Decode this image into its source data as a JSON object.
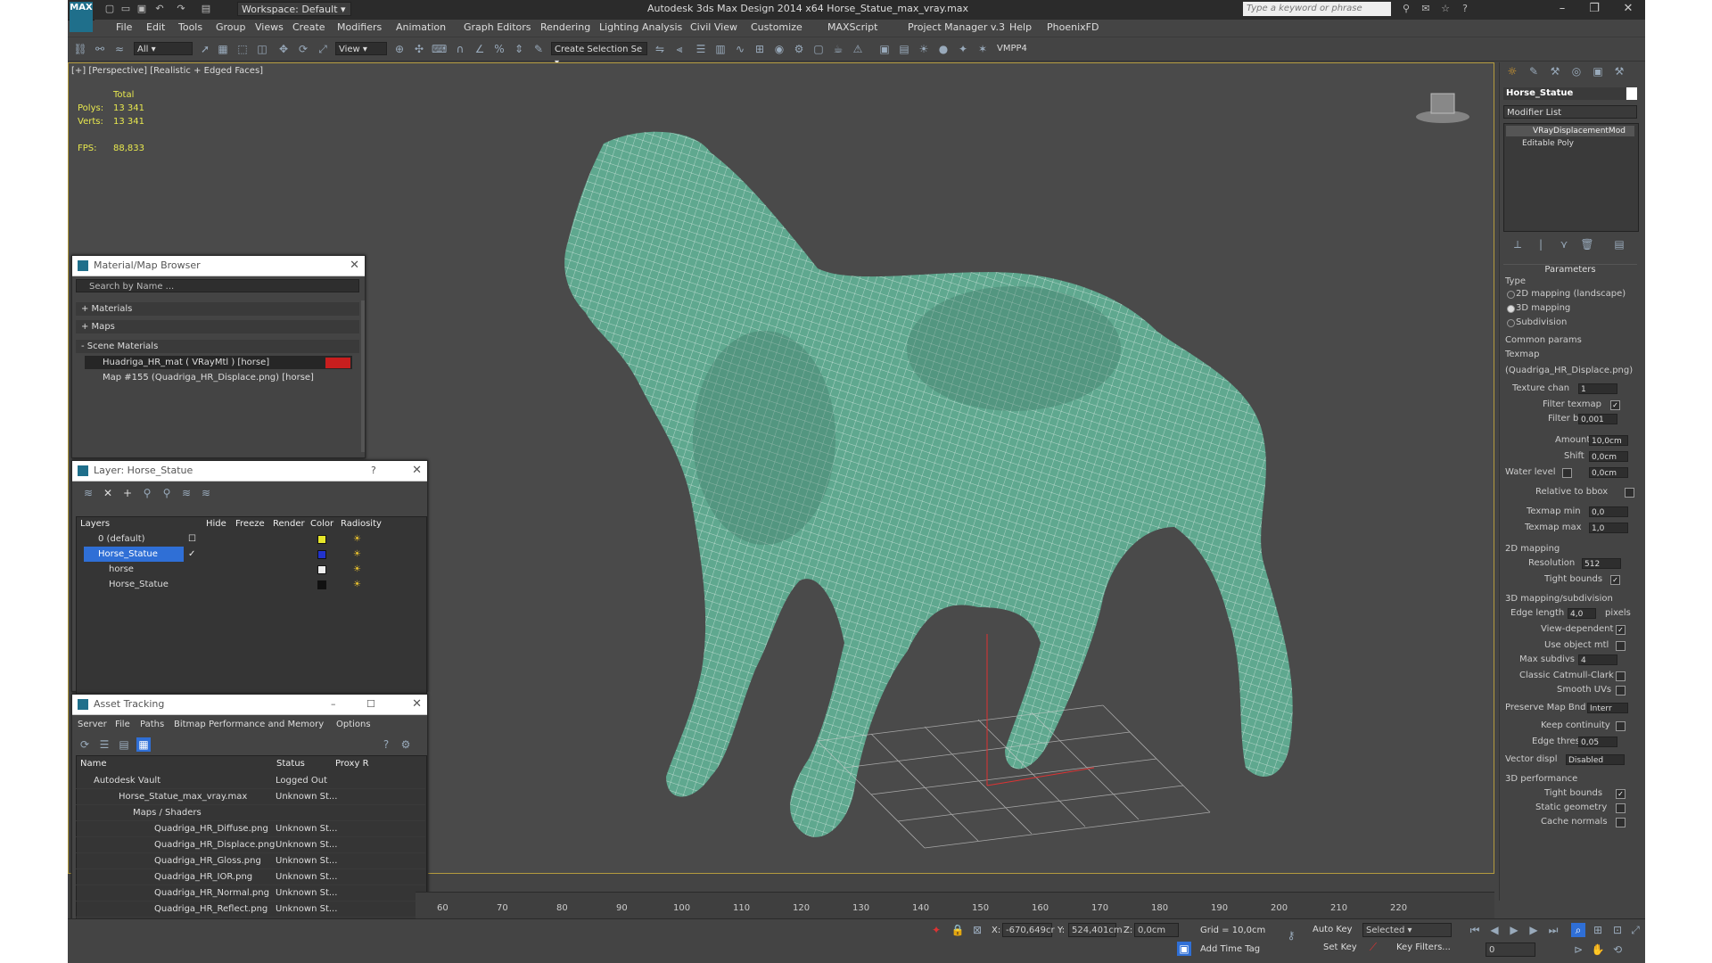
{
  "titlebar": {
    "app_title": "Autodesk 3ds Max Design 2014 x64      Horse_Statue_max_vray.max",
    "workspace": "Workspace: Default",
    "search_placeholder": "Type a keyword or phrase",
    "logo": "MAX"
  },
  "menu": [
    "File",
    "Edit",
    "Tools",
    "Group",
    "Views",
    "Create",
    "Modifiers",
    "Animation",
    "Graph Editors",
    "Rendering",
    "Lighting Analysis",
    "Civil View",
    "Customize",
    "MAXScript",
    "Project Manager v.3",
    "Help",
    "PhoenixFD"
  ],
  "toolbar": {
    "selection_filter": "All",
    "ref_coord": "View",
    "named_selection": "Create Selection Se",
    "vmpp": "VMPP4"
  },
  "viewport": {
    "label": "[+] [Perspective] [Realistic + Edged Faces]",
    "stats": {
      "total_label": "Total",
      "polys_label": "Polys:",
      "polys": "13 341",
      "verts_label": "Verts:",
      "verts": "13 341",
      "fps_label": "FPS:",
      "fps": "88,833"
    },
    "colors": {
      "mesh": "#5fa88f",
      "wire": "#e8f2ee",
      "background": "#4a4a4a",
      "border": "#b49b3e"
    }
  },
  "material_browser": {
    "title": "Material/Map Browser",
    "search_placeholder": "Search by Name ...",
    "sections": [
      "+ Materials",
      "+ Maps",
      "- Scene Materials"
    ],
    "items": [
      "Huadriga_HR_mat  ( VRayMtl ) [horse]",
      "Map #155 (Quadriga_HR_Displace.png) [horse]"
    ]
  },
  "layer_dialog": {
    "title": "Layer: Horse_Statue",
    "help": "?",
    "columns": [
      "Layers",
      "Hide",
      "Freeze",
      "Render",
      "Color",
      "Radiosity"
    ],
    "rows": [
      {
        "name": "0 (default)",
        "color": "#e6e62a",
        "selected": false
      },
      {
        "name": "Horse_Statue",
        "color": "#2233cc",
        "selected": true
      },
      {
        "name": "horse",
        "color": "#eeeeee",
        "selected": false
      },
      {
        "name": "Horse_Statue",
        "color": "#111111",
        "selected": false
      }
    ]
  },
  "asset_tracking": {
    "title": "Asset Tracking",
    "menu": [
      "Server",
      "File",
      "Paths",
      "Bitmap Performance and Memory",
      "Options"
    ],
    "columns": [
      "Name",
      "Status",
      "Proxy R"
    ],
    "rows": [
      {
        "name": "Autodesk Vault",
        "status": "Logged Out"
      },
      {
        "name": "Horse_Statue_max_vray.max",
        "status": "Unknown St..."
      },
      {
        "name": "Maps / Shaders",
        "status": ""
      },
      {
        "name": "Quadriga_HR_Diffuse.png",
        "status": "Unknown St..."
      },
      {
        "name": "Quadriga_HR_Displace.png",
        "status": "Unknown St..."
      },
      {
        "name": "Quadriga_HR_Gloss.png",
        "status": "Unknown St..."
      },
      {
        "name": "Quadriga_HR_IOR.png",
        "status": "Unknown St..."
      },
      {
        "name": "Quadriga_HR_Normal.png",
        "status": "Unknown St..."
      },
      {
        "name": "Quadriga_HR_Reflect.png",
        "status": "Unknown St..."
      }
    ]
  },
  "command_panel": {
    "object_name": "Horse_Statue",
    "modifier_list": "Modifier List",
    "stack": [
      "VRayDisplacementMod",
      "Editable Poly"
    ],
    "parameters_header": "Parameters",
    "type_label": "Type",
    "type_options": [
      "2D mapping (landscape)",
      "3D mapping",
      "Subdivision"
    ],
    "common_params": "Common params",
    "texmap_label": "Texmap",
    "texmap_value": "(Quadriga_HR_Displace.png)",
    "texture_chan_label": "Texture chan",
    "texture_chan": "1",
    "filter_texmap": "Filter texmap",
    "filter_blur_label": "Filter blur",
    "filter_blur": "0,001",
    "amount_label": "Amount",
    "amount": "10,0cm",
    "shift_label": "Shift",
    "shift": "0,0cm",
    "water_level_label": "Water level",
    "water_level": "0,0cm",
    "relative_bbox": "Relative to bbox",
    "texmap_min_label": "Texmap min",
    "texmap_min": "0,0",
    "texmap_max_label": "Texmap max",
    "texmap_max": "1,0",
    "mapping2d": "2D mapping",
    "resolution_label": "Resolution",
    "resolution": "512",
    "tight_bounds": "Tight bounds",
    "mapping3d": "3D mapping/subdivision",
    "edge_length_label": "Edge length",
    "edge_length": "4,0",
    "pixels": "pixels",
    "view_dependent": "View-dependent",
    "use_object_mtl": "Use object mtl",
    "max_subdivs_label": "Max subdivs",
    "max_subdivs": "4",
    "classic_catmull": "Classic Catmull-Clark",
    "smooth_uvs": "Smooth UVs",
    "preserve_map_label": "Preserve Map Bnd",
    "preserve_map": "Interr",
    "keep_continuity": "Keep continuity",
    "edge_thresh_label": "Edge thresh",
    "edge_thresh": "0,05",
    "vector_disp_label": "Vector displ",
    "vector_disp": "Disabled",
    "perf_header": "3D performance",
    "tight_bounds2": "Tight bounds",
    "static_geometry": "Static geometry",
    "cache_normals": "Cache normals"
  },
  "timeline": {
    "ticks": [
      "60",
      "70",
      "80",
      "90",
      "100",
      "110",
      "120",
      "130",
      "140",
      "150",
      "160",
      "170",
      "180",
      "190",
      "200",
      "210",
      "220"
    ]
  },
  "status": {
    "x_label": "X:",
    "x": "-670,649cr",
    "y_label": "Y:",
    "y": "524,401cm",
    "z_label": "Z:",
    "z": "0,0cm",
    "grid": "Grid = 10,0cm",
    "auto_key": "Auto Key",
    "selected": "Selected",
    "set_key": "Set Key",
    "key_filters": "Key Filters...",
    "add_time_tag": "Add Time Tag",
    "frame": "0"
  }
}
